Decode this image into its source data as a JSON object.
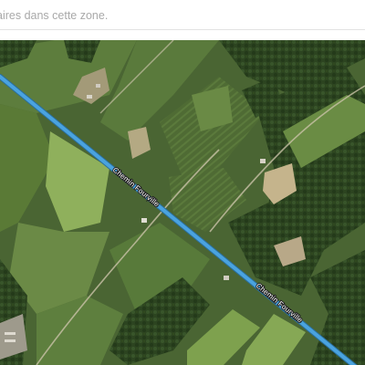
{
  "search_bar": {
    "message": "aires dans cette zone."
  },
  "map": {
    "type": "satellite",
    "road": {
      "name": "Chemin Fourville",
      "color": "#4aa3df"
    }
  }
}
